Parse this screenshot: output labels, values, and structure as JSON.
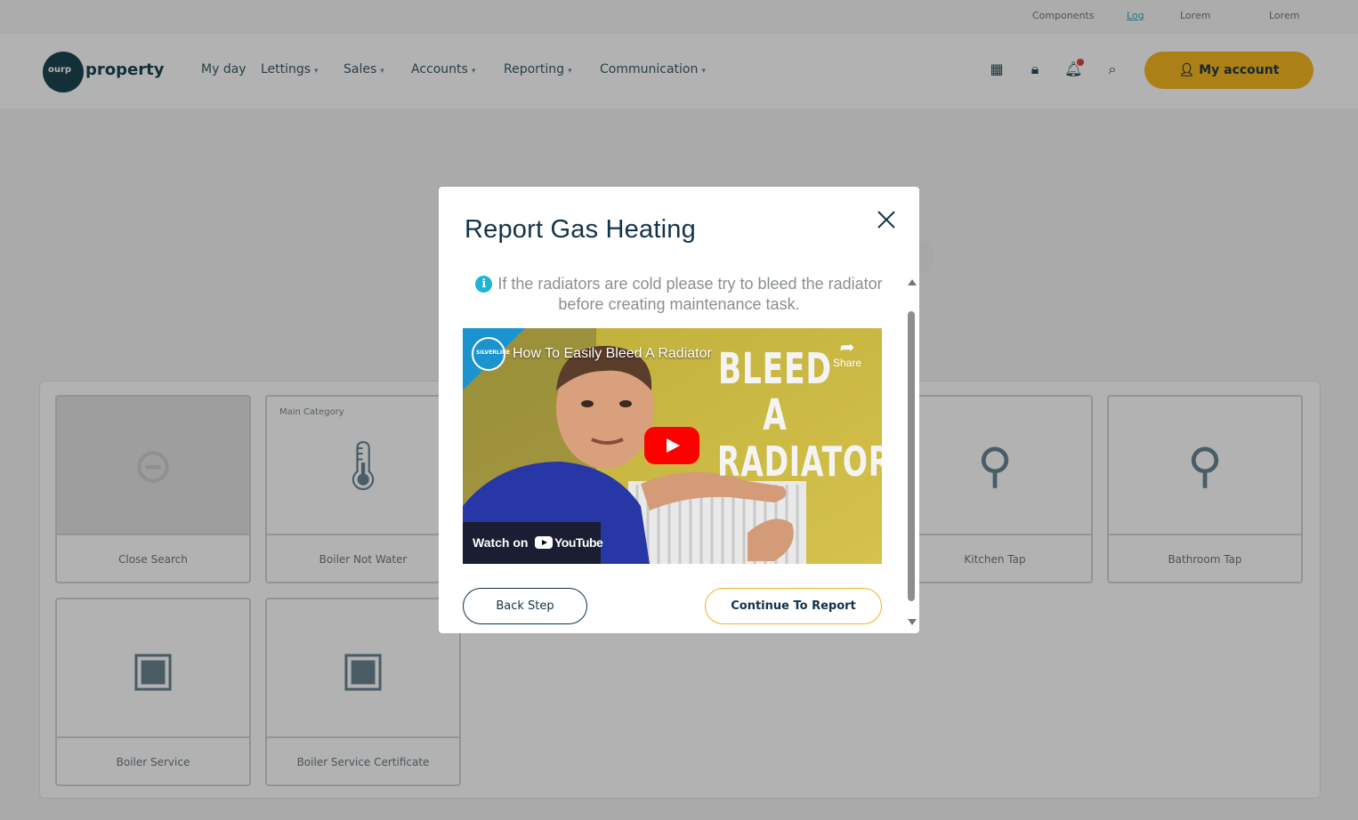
{
  "utility_links": [
    "Components",
    "Log",
    "Lorem",
    "Lorem"
  ],
  "header": {
    "logo_text": "property",
    "logo_mark": "ourp",
    "nav": [
      {
        "label": "My day",
        "has_menu": false
      },
      {
        "label": "Lettings",
        "has_menu": true
      },
      {
        "label": "Sales",
        "has_menu": true
      },
      {
        "label": "Accounts",
        "has_menu": true
      },
      {
        "label": "Reporting",
        "has_menu": true
      },
      {
        "label": "Communication",
        "has_menu": true
      }
    ],
    "account_label": "My account",
    "icons": [
      "grid-icon",
      "lock-icon",
      "bell-icon",
      "search-icon"
    ]
  },
  "tiles": [
    {
      "label": "Close Search",
      "icon": "back-arrow-icon"
    },
    {
      "label": "Boiler Not Water",
      "icon": "thermometer-icon",
      "category": "Main Category"
    },
    {
      "label": "Kitchen Tap",
      "icon": "tap-icon"
    },
    {
      "label": "Bathroom Tap",
      "icon": "tap-icon"
    },
    {
      "label": "Boiler Service",
      "icon": "boiler-icon"
    },
    {
      "label": "Boiler Service Certificate",
      "icon": "boiler-certificate-icon"
    }
  ],
  "modal": {
    "title": "Report Gas Heating",
    "info_text": "If the radiators are cold please try to bleed the radiator before creating maintenance task.",
    "video": {
      "title": "How To Easily Bleed A Radiator",
      "overlay_line1": "BLEED A",
      "overlay_line2": "RADIATOR",
      "share_label": "Share",
      "watch_on_label": "Watch on",
      "platform_label": "YouTube",
      "channel_badge": "SILVERLINE"
    },
    "back_label": "Back Step",
    "continue_label": "Continue To Report"
  },
  "colors": {
    "accent_yellow": "#f0b323",
    "title_navy": "#12334a",
    "info_blue": "#1fb3d6",
    "play_red": "#ff0000"
  }
}
